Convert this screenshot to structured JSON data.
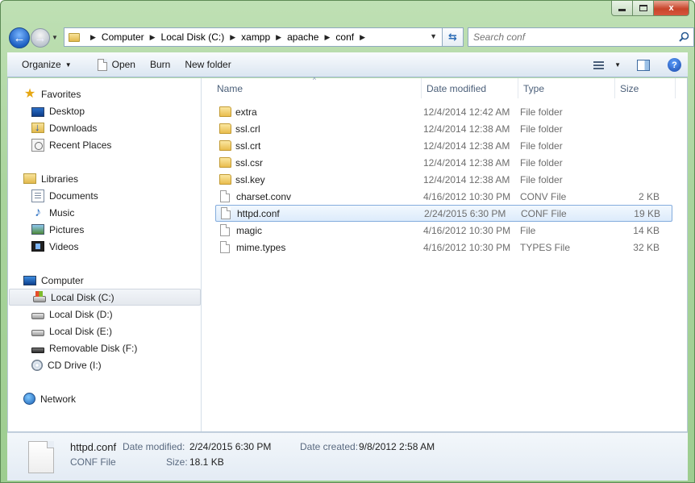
{
  "window": {
    "caption": {
      "minimize": "—",
      "maximize": "□",
      "close": "x"
    }
  },
  "nav": {
    "breadcrumb": [
      "Computer",
      "Local Disk (C:)",
      "xampp",
      "apache",
      "conf"
    ],
    "search_placeholder": "Search conf"
  },
  "toolbar": {
    "organize": "Organize",
    "open": "Open",
    "burn": "Burn",
    "new_folder": "New folder",
    "help": "?"
  },
  "sidebar": {
    "favorites": {
      "label": "Favorites",
      "items": [
        "Desktop",
        "Downloads",
        "Recent Places"
      ]
    },
    "libraries": {
      "label": "Libraries",
      "items": [
        "Documents",
        "Music",
        "Pictures",
        "Videos"
      ]
    },
    "computer": {
      "label": "Computer",
      "items": [
        "Local Disk (C:)",
        "Local Disk (D:)",
        "Local Disk (E:)",
        "Removable Disk (F:)",
        "CD Drive (I:)"
      ]
    },
    "network": {
      "label": "Network"
    }
  },
  "columns": {
    "name": "Name",
    "date": "Date modified",
    "type": "Type",
    "size": "Size"
  },
  "files": [
    {
      "name": "extra",
      "date": "12/4/2014 12:42 AM",
      "type": "File folder",
      "size": "",
      "kind": "folder"
    },
    {
      "name": "ssl.crl",
      "date": "12/4/2014 12:38 AM",
      "type": "File folder",
      "size": "",
      "kind": "folder"
    },
    {
      "name": "ssl.crt",
      "date": "12/4/2014 12:38 AM",
      "type": "File folder",
      "size": "",
      "kind": "folder"
    },
    {
      "name": "ssl.csr",
      "date": "12/4/2014 12:38 AM",
      "type": "File folder",
      "size": "",
      "kind": "folder"
    },
    {
      "name": "ssl.key",
      "date": "12/4/2014 12:38 AM",
      "type": "File folder",
      "size": "",
      "kind": "folder"
    },
    {
      "name": "charset.conv",
      "date": "4/16/2012 10:30 PM",
      "type": "CONV File",
      "size": "2 KB",
      "kind": "file"
    },
    {
      "name": "httpd.conf",
      "date": "2/24/2015 6:30 PM",
      "type": "CONF File",
      "size": "19 KB",
      "kind": "file"
    },
    {
      "name": "magic",
      "date": "4/16/2012 10:30 PM",
      "type": "File",
      "size": "14 KB",
      "kind": "file"
    },
    {
      "name": "mime.types",
      "date": "4/16/2012 10:30 PM",
      "type": "TYPES File",
      "size": "32 KB",
      "kind": "file"
    }
  ],
  "selected_file": "httpd.conf",
  "details": {
    "name": "httpd.conf",
    "type": "CONF File",
    "modified_label": "Date modified:",
    "modified_value": "2/24/2015 6:30 PM",
    "created_label": "Date created:",
    "created_value": "9/8/2012 2:58 AM",
    "size_label": "Size:",
    "size_value": "18.1 KB"
  },
  "colors": {
    "chrome": "#a9d49d",
    "selection": "#dcebfb",
    "selection_border": "#84acdd"
  }
}
